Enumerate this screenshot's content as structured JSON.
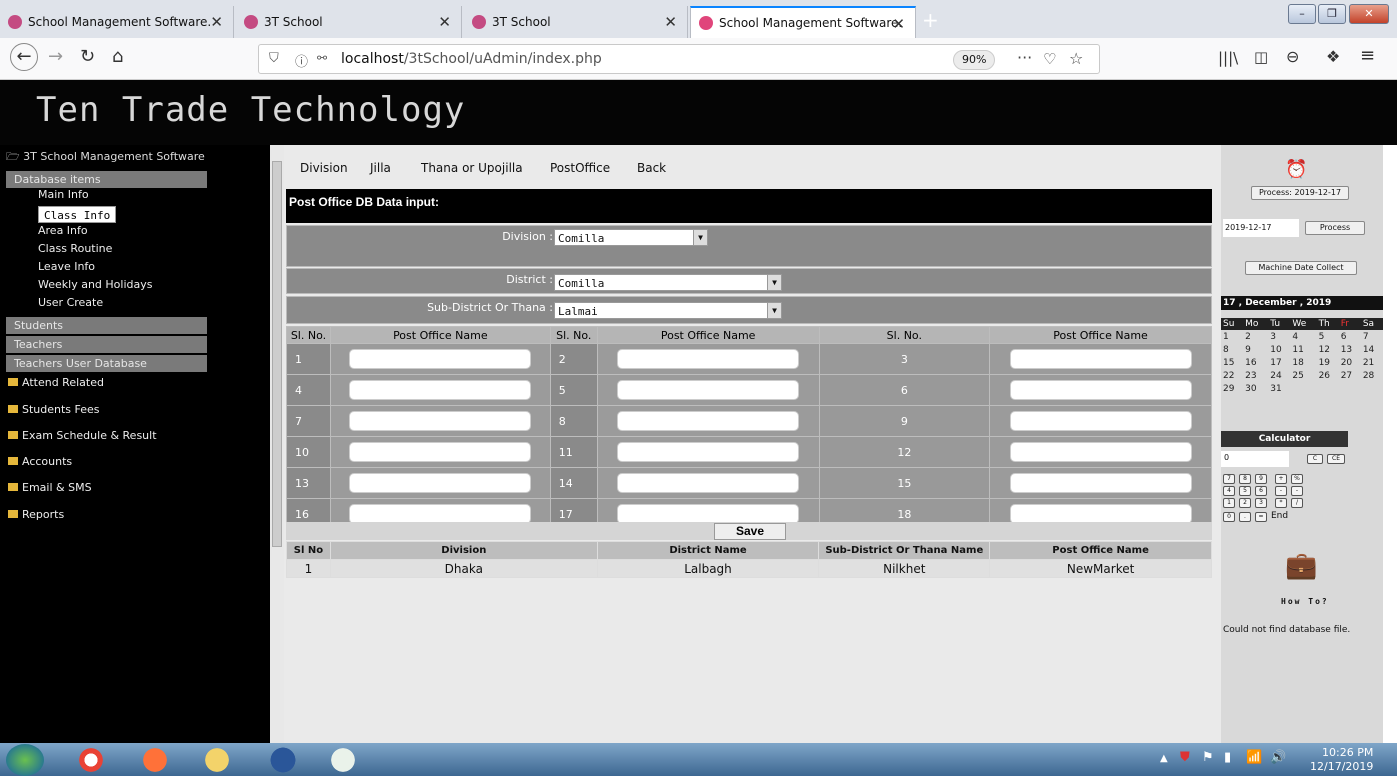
{
  "browser": {
    "tabs": [
      {
        "label": "School Management Software.",
        "active": false
      },
      {
        "label": "3T School",
        "active": false
      },
      {
        "label": "3T School",
        "active": false
      },
      {
        "label": "School Management Software.",
        "active": true
      }
    ],
    "url_prefix": "localhost",
    "url_path": "/3tSchool/uAdmin/index.php",
    "zoom": "90%"
  },
  "header": {
    "brand": "Ten Trade Technology"
  },
  "sidebar": {
    "root": "3T School Management Software",
    "groups": [
      {
        "label": "Database items"
      },
      {
        "label": "Students"
      },
      {
        "label": "Teachers"
      },
      {
        "label": "Teachers User Database"
      }
    ],
    "db_items": [
      "Main Info",
      "Class Info",
      "Area Info",
      "Class Routine",
      "Leave Info",
      "Weekly and Holidays",
      "User Create"
    ],
    "folders": [
      "Attend Related",
      "Students Fees",
      "Exam Schedule & Result",
      "Accounts",
      "Email & SMS",
      "Reports"
    ]
  },
  "main": {
    "menu": [
      "Division",
      "Jilla",
      "Thana or Upojilla",
      "PostOffice",
      "Back"
    ],
    "form_title": "Post Office DB Data input:",
    "division_label": "Division :",
    "division_value": "Comilla",
    "district_label": "District :",
    "district_value": "Comilla",
    "subdistrict_label": "Sub-District Or Thana :",
    "subdistrict_value": "Lalmai",
    "grid_headers": [
      "Sl. No.",
      "Post Office Name",
      "Sl. No.",
      "Post Office Name",
      "Sl. No.",
      "Post Office Name"
    ],
    "grid_rows": [
      [
        "1",
        "2",
        "3"
      ],
      [
        "4",
        "5",
        "6"
      ],
      [
        "7",
        "8",
        "9"
      ],
      [
        "10",
        "11",
        "12"
      ],
      [
        "13",
        "14",
        "15"
      ],
      [
        "16",
        "17",
        "18"
      ]
    ],
    "save_label": "Save",
    "result_headers": [
      "Sl No",
      "Division",
      "District Name",
      "Sub-District Or Thana Name",
      "Post Office Name"
    ],
    "result_rows": [
      [
        "1",
        "Dhaka",
        "Lalbagh",
        "Nilkhet",
        "NewMarket"
      ]
    ]
  },
  "right": {
    "process_btn": "Process: 2019-12-17",
    "date_value": "2019-12-17",
    "process_btn2": "Process",
    "machine_btn": "Machine Date Collect",
    "cal_title": "17 , December , 2019",
    "cal_days": [
      "Su",
      "Mo",
      "Tu",
      "We",
      "Th",
      "Fr",
      "Sa"
    ],
    "cal_weeks": [
      [
        "1",
        "2",
        "3",
        "4",
        "5",
        "6",
        "7"
      ],
      [
        "8",
        "9",
        "10",
        "11",
        "12",
        "13",
        "14"
      ],
      [
        "15",
        "16",
        "17",
        "18",
        "19",
        "20",
        "21"
      ],
      [
        "22",
        "23",
        "24",
        "25",
        "26",
        "27",
        "28"
      ],
      [
        "29",
        "30",
        "31",
        "",
        "",
        "",
        ""
      ]
    ],
    "calc_title": "Calculator",
    "calc_value": "0",
    "calc_keys": [
      "C",
      "CE",
      "7",
      "8",
      "9",
      "+",
      "%",
      "4",
      "5",
      "6",
      "-",
      "-",
      "1",
      "2",
      "3",
      "*",
      "/",
      "0",
      ".",
      "=",
      "End"
    ],
    "howto": "How To?",
    "error": "Could not find database file."
  },
  "taskbar": {
    "time": "10:26 PM",
    "date": "12/17/2019"
  }
}
